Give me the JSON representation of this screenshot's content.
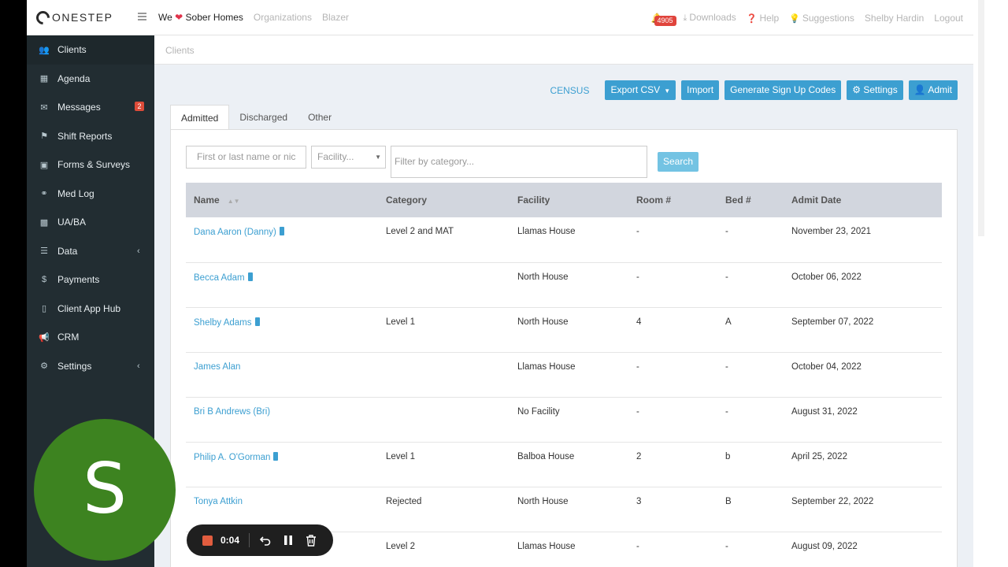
{
  "header": {
    "logo": "ONESTEP",
    "brand_prefix": "We",
    "brand_suffix": "Sober Homes",
    "nav": [
      "Organizations",
      "Blazer"
    ],
    "notifications": "4905",
    "downloads": "Downloads",
    "help": "Help",
    "suggestions": "Suggestions",
    "user": "Shelby Hardin",
    "logout": "Logout"
  },
  "sidebar": {
    "items": [
      {
        "label": "Clients",
        "icon": "users-icon"
      },
      {
        "label": "Agenda",
        "icon": "calendar-icon"
      },
      {
        "label": "Messages",
        "icon": "envelope-icon",
        "count": "2"
      },
      {
        "label": "Shift Reports",
        "icon": "flag-icon"
      },
      {
        "label": "Forms & Surveys",
        "icon": "file-icon"
      },
      {
        "label": "Med Log",
        "icon": "pills-icon"
      },
      {
        "label": "UA/BA",
        "icon": "clipboard-icon"
      },
      {
        "label": "Data",
        "icon": "database-icon"
      },
      {
        "label": "Payments",
        "icon": "dollar-icon"
      },
      {
        "label": "Client App Hub",
        "icon": "mobile-icon"
      },
      {
        "label": "CRM",
        "icon": "bullhorn-icon"
      },
      {
        "label": "Settings",
        "icon": "gear-icon"
      }
    ]
  },
  "breadcrumb": "Clients",
  "actions": {
    "census": "CENSUS",
    "export": "Export CSV",
    "import": "Import",
    "signup": "Generate Sign Up Codes",
    "settings": "Settings",
    "admit": "Admit"
  },
  "tabs": [
    "Admitted",
    "Discharged",
    "Other"
  ],
  "filters": {
    "name_placeholder": "First or last name or nic",
    "facility_placeholder": "Facility...",
    "category_placeholder": "Filter by category...",
    "search": "Search"
  },
  "table": {
    "columns": [
      "Name",
      "Category",
      "Facility",
      "Room #",
      "Bed #",
      "Admit Date"
    ],
    "rows": [
      {
        "name": "Dana Aaron (Danny)",
        "tag": true,
        "category": "Level 2 and MAT",
        "facility": "Llamas House",
        "room": "-",
        "bed": "-",
        "date": "November 23, 2021"
      },
      {
        "name": "Becca Adam",
        "tag": true,
        "category": "",
        "facility": "North House",
        "room": "-",
        "bed": "-",
        "date": "October 06, 2022"
      },
      {
        "name": "Shelby Adams",
        "tag": true,
        "category": "Level 1",
        "facility": "North House",
        "room": "4",
        "bed": "A",
        "date": "September 07, 2022"
      },
      {
        "name": "James Alan",
        "tag": false,
        "category": "",
        "facility": "Llamas House",
        "room": "-",
        "bed": "-",
        "date": "October 04, 2022"
      },
      {
        "name": "Bri B Andrews (Bri)",
        "tag": false,
        "category": "",
        "facility": "No Facility",
        "room": "-",
        "bed": "-",
        "date": "August 31, 2022"
      },
      {
        "name": "Philip A. O'Gorman",
        "tag": true,
        "category": "Level 1",
        "facility": "Balboa House",
        "room": "2",
        "bed": "b",
        "date": "April 25, 2022"
      },
      {
        "name": "Tonya Attkin",
        "tag": false,
        "category": "Rejected",
        "facility": "North House",
        "room": "3",
        "bed": "B",
        "date": "September 22, 2022"
      },
      {
        "name": "",
        "tag": false,
        "category": "Level 2",
        "facility": "Llamas House",
        "room": "-",
        "bed": "-",
        "date": "August 09, 2022"
      }
    ]
  },
  "avatar_letter": "S",
  "recorder": {
    "time": "0:04"
  }
}
